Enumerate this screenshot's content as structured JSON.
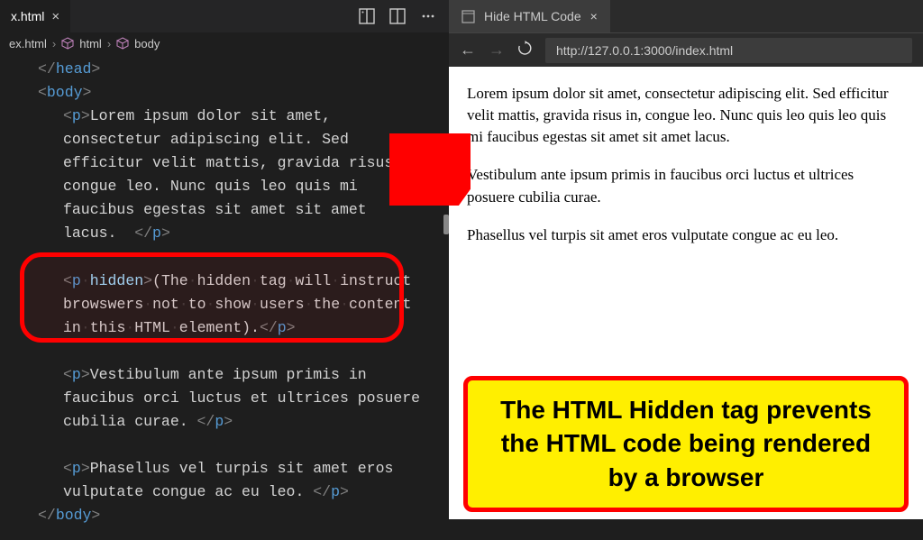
{
  "editor_tab": {
    "filename": "x.html"
  },
  "breadcrumbs": {
    "item1": "ex.html",
    "item2": "html",
    "item3": "body"
  },
  "code": {
    "head_close": "head",
    "body_open": "body",
    "body_close": "body",
    "p_tag": "p",
    "hidden_attr": "hidden",
    "p1_text_a": "Lorem ipsum dolor sit amet,",
    "p1_text_b": "consectetur adipiscing elit. Sed",
    "p1_text_c": "efficitur velit mattis, gravida risus in",
    "p1_text_d": "congue leo. Nunc quis leo quis mi",
    "p1_text_e": "faucibus egestas sit amet sit amet",
    "p1_text_f": "lacus.  ",
    "p2_text_a": "(The hidden tag will instruct",
    "p2_text_b": "browswers not to show users the content",
    "p2_text_c": "in this HTML element).",
    "p3_text_a": "Vestibulum ante ipsum primis in",
    "p3_text_b": "faucibus orci luctus et ultrices posuere",
    "p3_text_c": "cubilia curae. ",
    "p4_text_a": "Phasellus vel turpis sit amet eros",
    "p4_text_b": "vulputate congue ac eu leo. "
  },
  "browser_tab": {
    "title": "Hide HTML Code"
  },
  "url": "http://127.0.0.1:3000/index.html",
  "page": {
    "p1": "Lorem ipsum dolor sit amet, consectetur adipiscing elit. Sed efficitur velit mattis, gravida risus in, congue leo. Nunc quis leo quis leo quis mi faucibus egestas sit amet sit amet lacus.",
    "p2": "Vestibulum ante ipsum primis in faucibus orci luctus et ultrices posuere cubilia curae.",
    "p3": "Phasellus vel turpis sit amet eros vulputate congue ac eu leo."
  },
  "callout": "The HTML Hidden tag prevents the HTML code being rendered by a browser"
}
